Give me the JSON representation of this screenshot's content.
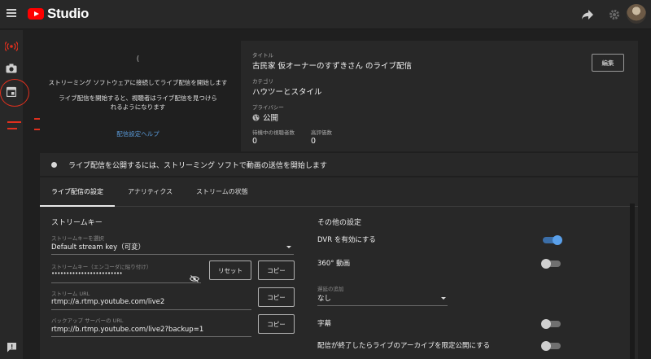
{
  "app": {
    "name": "Studio"
  },
  "preview": {
    "spinner": "(",
    "message1": "ストリーミング ソフトウェアに接続してライブ配信を開始します",
    "message2": "ライブ配信を開始すると、視聴者はライブ配信を見つけられるようになります",
    "help_link": "配信設定ヘルプ"
  },
  "info": {
    "title_label": "タイトル",
    "title": "古民家 仮オーナーのすずきさん のライブ配信",
    "category_label": "カテゴリ",
    "category": "ハウツーとスタイル",
    "privacy_label": "プライバシー",
    "privacy": "公開",
    "viewers_label": "待機中の視聴者数",
    "viewers": "0",
    "likes_label": "高評価数",
    "likes": "0",
    "edit_button": "編集"
  },
  "status": {
    "message": "ライブ配信を公開するには、ストリーミング ソフトで動画の送信を開始します"
  },
  "tabs": [
    {
      "label": "ライブ配信の設定",
      "active": true
    },
    {
      "label": "アナリティクス",
      "active": false
    },
    {
      "label": "ストリームの状態",
      "active": false
    }
  ],
  "stream_key": {
    "section_title": "ストリームキー",
    "select_label": "ストリームキーを選択",
    "select_value": "Default stream key（可変）",
    "key_label": "ストリームキー（エンコーダに貼り付け）",
    "key_value": "••••••••••••••••••••••••",
    "reset_button": "リセット",
    "copy_button": "コピー",
    "url_label": "ストリーム URL",
    "url_value": "rtmp://a.rtmp.youtube.com/live2",
    "backup_label": "バックアップ サーバーの URL",
    "backup_value": "rtmp://b.rtmp.youtube.com/live2?backup=1"
  },
  "other": {
    "section_title": "その他の設定",
    "dvr_label": "DVR を有効にする",
    "dvr_on": true,
    "vr_label": "360° 動画",
    "vr_on": false,
    "delay_label": "遅延の追加",
    "delay_value": "なし",
    "captions_label": "字幕",
    "captions_on": false,
    "cutoff_label": "配信が終了したらライブのアーカイブを限定公開にする"
  },
  "colors": {
    "accent": "#3ea6ff",
    "brand": "#ff0000",
    "annotation": "#e0301e"
  }
}
